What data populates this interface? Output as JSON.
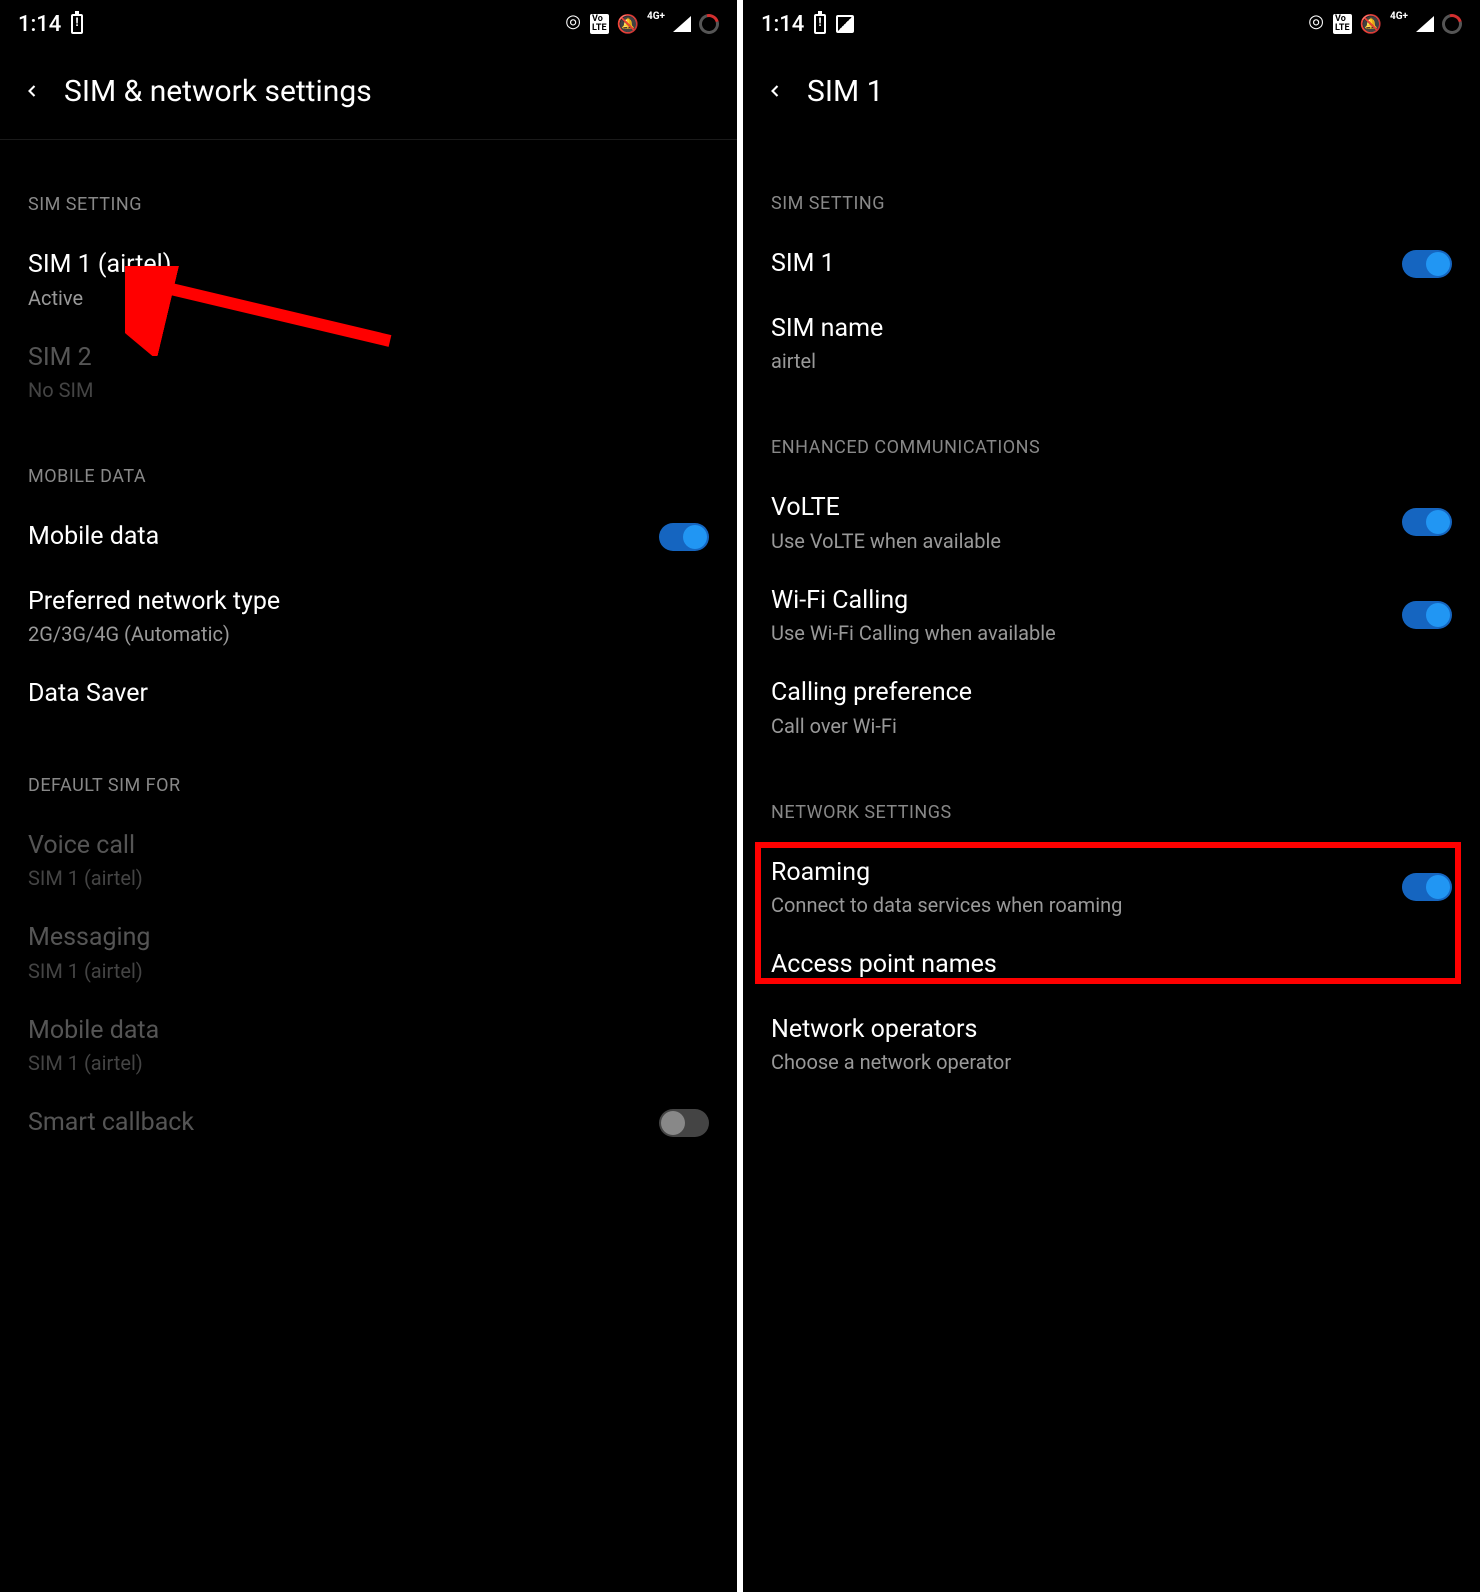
{
  "left": {
    "status": {
      "time": "1:14"
    },
    "header": {
      "title": "SIM & network settings"
    },
    "sections": {
      "sim_setting": {
        "label": "SIM SETTING",
        "sim1": {
          "title": "SIM 1  (airtel)",
          "subtitle": "Active"
        },
        "sim2": {
          "title": "SIM 2",
          "subtitle": "No SIM"
        }
      },
      "mobile_data": {
        "label": "MOBILE DATA",
        "mobile_data": {
          "title": "Mobile data"
        },
        "preferred": {
          "title": "Preferred network type",
          "subtitle": "2G/3G/4G (Automatic)"
        },
        "data_saver": {
          "title": "Data Saver"
        }
      },
      "default_sim": {
        "label": "DEFAULT SIM FOR",
        "voice": {
          "title": "Voice call",
          "subtitle": "SIM 1  (airtel)"
        },
        "messaging": {
          "title": "Messaging",
          "subtitle": "SIM 1  (airtel)"
        },
        "mobiledata": {
          "title": "Mobile data",
          "subtitle": "SIM 1  (airtel)"
        },
        "smart": {
          "title": "Smart callback"
        }
      }
    }
  },
  "right": {
    "status": {
      "time": "1:14"
    },
    "header": {
      "title": "SIM 1"
    },
    "sections": {
      "sim_setting": {
        "label": "SIM SETTING",
        "sim1": {
          "title": "SIM 1"
        },
        "sim_name": {
          "title": "SIM name",
          "subtitle": "airtel"
        }
      },
      "enhanced": {
        "label": "ENHANCED COMMUNICATIONS",
        "volte": {
          "title": "VoLTE",
          "subtitle": "Use VoLTE when available"
        },
        "wifi_calling": {
          "title": "Wi-Fi Calling",
          "subtitle": "Use Wi-Fi Calling when available"
        },
        "calling_pref": {
          "title": "Calling preference",
          "subtitle": "Call over Wi-Fi"
        }
      },
      "network": {
        "label": "NETWORK SETTINGS",
        "roaming": {
          "title": "Roaming",
          "subtitle": "Connect to data services when roaming"
        },
        "apn": {
          "title": "Access point names"
        },
        "operators": {
          "title": "Network operators",
          "subtitle": "Choose a network operator"
        }
      }
    }
  }
}
